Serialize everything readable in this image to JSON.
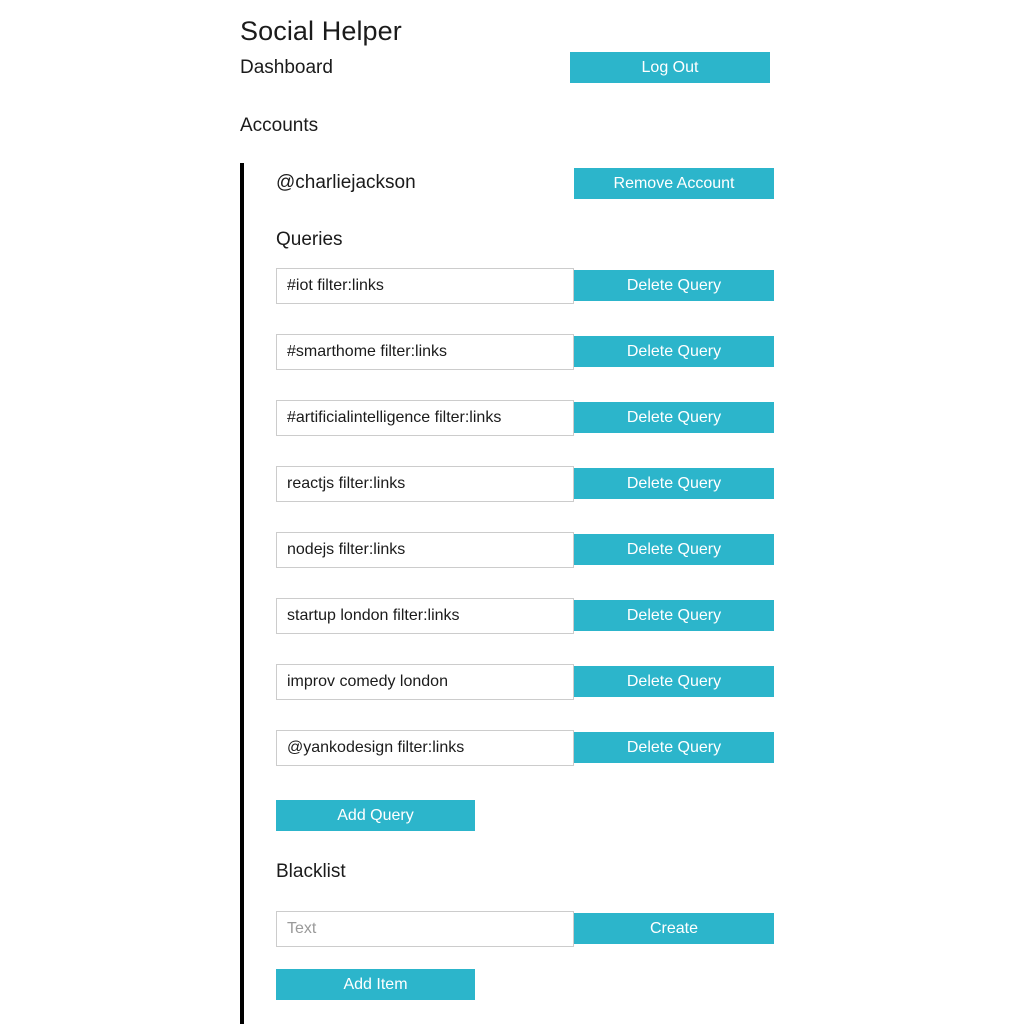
{
  "app": {
    "title": "Social Helper",
    "subtitle": "Dashboard",
    "accent_color": "#2cb5cb",
    "rule_color": "#000000",
    "input_border_color": "#cccccc",
    "placeholder_color": "#9a9a9a"
  },
  "header": {
    "logout_label": "Log Out"
  },
  "accounts_section": {
    "heading": "Accounts"
  },
  "account": {
    "handle": "@charliejackson",
    "remove_label": "Remove Account",
    "queries_heading": "Queries",
    "delete_query_label": "Delete Query",
    "add_query_label": "Add Query",
    "queries": [
      {
        "value": "#iot filter:links"
      },
      {
        "value": "#smarthome filter:links"
      },
      {
        "value": "#artificialintelligence filter:links"
      },
      {
        "value": "reactjs filter:links"
      },
      {
        "value": "nodejs filter:links"
      },
      {
        "value": "startup london filter:links"
      },
      {
        "value": "improv comedy london"
      },
      {
        "value": "@yankodesign filter:links"
      }
    ],
    "blacklist": {
      "heading": "Blacklist",
      "input_value": "",
      "input_placeholder": "Text",
      "create_label": "Create",
      "add_item_label": "Add Item"
    }
  }
}
